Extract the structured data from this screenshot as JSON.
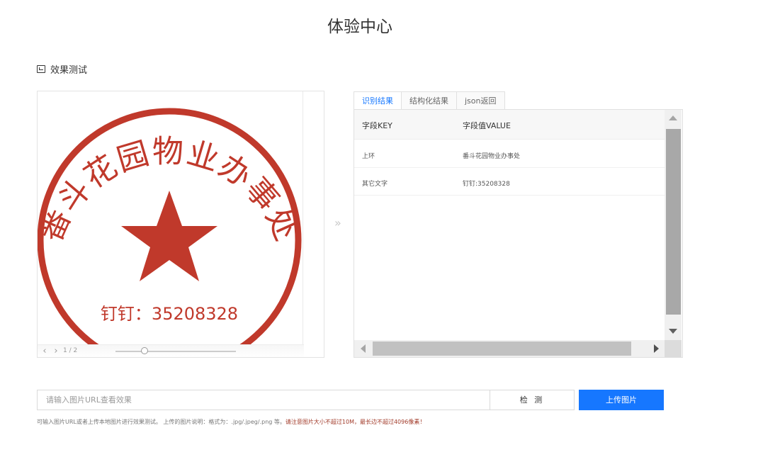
{
  "page": {
    "title": "体验中心"
  },
  "section": {
    "label": "效果测试",
    "icon": "code-icon"
  },
  "image_viewer": {
    "stamp": {
      "arc_text": "番斗花园物业办事处",
      "center_text": "钉钉：35208328",
      "color": "#c0392b"
    },
    "page_indicator": "1 / 2",
    "zoom_level": 0.25,
    "prev_icon": "chevron-left-icon",
    "next_icon": "chevron-right-icon"
  },
  "separator_icon": "double-chevron-right-icon",
  "separator_glyph": "»",
  "results": {
    "tabs": [
      {
        "label": "识别结果",
        "active": true
      },
      {
        "label": "结构化结果",
        "active": false
      },
      {
        "label": "json返回",
        "active": false
      }
    ],
    "columns": {
      "key": "字段KEY",
      "value": "字段值VALUE"
    },
    "rows": [
      {
        "key": "上环",
        "value": "番斗花园物业办事处"
      },
      {
        "key": "其它文字",
        "value": "钉钉:35208328"
      }
    ]
  },
  "input": {
    "placeholder": "请输入图片URL查看效果",
    "value": ""
  },
  "buttons": {
    "detect": "检 测",
    "upload": "上传图片"
  },
  "hint": {
    "normal": "可输入图片URL或者上传本地图片进行效果测试。 上传的图片说明：格式为：.jpg/.jpeg/.png 等。",
    "warning": "请注意图片大小不超过10M，最长边不超过4096像素！"
  },
  "colors": {
    "accent": "#1677ff",
    "stamp_red": "#c0392b",
    "warning": "#a23b2a"
  }
}
